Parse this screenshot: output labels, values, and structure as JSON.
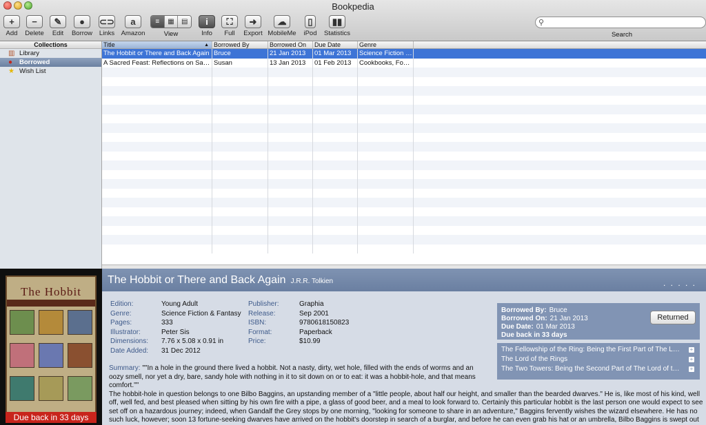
{
  "window": {
    "title": "Bookpedia"
  },
  "toolbar": {
    "add": "Add",
    "delete": "Delete",
    "edit": "Edit",
    "borrow": "Borrow",
    "links": "Links",
    "amazon": "Amazon",
    "view": "View",
    "info": "Info",
    "full": "Full",
    "export": "Export",
    "mobileme": "MobileMe",
    "ipod": "iPod",
    "statistics": "Statistics",
    "search_label": "Search"
  },
  "icons": {
    "add": "plus-icon",
    "delete": "minus-icon",
    "edit": "pencil-icon",
    "borrow": "person-icon",
    "links": "chain-icon",
    "amazon": "amazon-icon",
    "info": "info-icon",
    "full": "fullscreen-icon",
    "export": "arrow-right-icon",
    "mobileme": "cloud-icon",
    "ipod": "ipod-icon",
    "statistics": "bar-chart-icon"
  },
  "sidebar": {
    "header": "Collections",
    "items": [
      {
        "label": "Library",
        "icon": "books-icon"
      },
      {
        "label": "Borrowed",
        "icon": "person-icon",
        "selected": true
      },
      {
        "label": "Wish List",
        "icon": "star-icon"
      }
    ]
  },
  "table": {
    "columns": [
      "Title",
      "Borrowed By",
      "Borrowed On",
      "Due Date",
      "Genre"
    ],
    "rows": [
      [
        "The Hobbit or There and Back Again",
        "Bruce",
        "21 Jan 2013",
        "01 Mar 2013",
        "Science Fiction & Fantasy"
      ],
      [
        "A Sacred Feast: Reflections on Sacred Jewish Food",
        "Susan",
        "13 Jan 2013",
        "01 Feb 2013",
        "Cookbooks, Food & Wine"
      ]
    ]
  },
  "detail": {
    "title": "The Hobbit or There and Back Again",
    "author": "J.R.R. Tolkien",
    "dots": ". . . . .",
    "cover_title": "The Hobbit",
    "due_banner": "Due back in 33 days",
    "left_fields": [
      {
        "k": "Edition:",
        "v": "Young Adult"
      },
      {
        "k": "Genre:",
        "v": "Science Fiction & Fantasy"
      },
      {
        "k": "Pages:",
        "v": "333"
      },
      {
        "k": "Illustrator:",
        "v": "Peter Sis"
      },
      {
        "k": "Dimensions:",
        "v": "7.76 x 5.08 x 0.91 in"
      },
      {
        "k": "Date Added:",
        "v": "31 Dec 2012"
      }
    ],
    "right_fields": [
      {
        "k": "Publisher:",
        "v": "Graphia"
      },
      {
        "k": "Release:",
        "v": "Sep 2001"
      },
      {
        "k": "ISBN:",
        "v": "9780618150823"
      },
      {
        "k": "Format:",
        "v": "Paperback"
      },
      {
        "k": "Price:",
        "v": "$10.99"
      }
    ],
    "summary_label": "Summary:",
    "summary_quote": "\"\"In a hole in the ground there lived a hobbit. Not a nasty, dirty, wet hole, filled with the ends of worms and an oozy smell, nor yet a dry, bare, sandy hole with nothing in it to sit down on or to eat: it was a hobbit-hole, and that means comfort.\"\"",
    "summary_body": "The hobbit-hole in question belongs to one Bilbo Baggins, an upstanding member of a \"little people, about half our height, and smaller than the bearded dwarves.\" He is, like most of his kind, well off, well fed, and best pleased when sitting by his own fire with a pipe, a glass of good beer, and a meal to look forward to. Certainly this particular hobbit is the last person one would expect to see set off on a hazardous journey; indeed, when Gandalf the Grey stops by one morning, \"looking for someone to share in an adventure,\" Baggins fervently wishes the wizard elsewhere. He has no such luck, however; soon 13 fortune-seeking dwarves have arrived on the hobbit's doorstep in search of a burglar, and before he can even grab his hat or an umbrella, Bilbo Baggins is swept out his door and into a dangerous adventure.",
    "loan": {
      "borrowed_by_label": "Borrowed By:",
      "borrowed_by": "Bruce",
      "borrowed_on_label": "Borrowed On:",
      "borrowed_on": "21 Jan 2013",
      "due_date_label": "Due Date:",
      "due_date": "01 Mar 2013",
      "due_back": "Due back in 33 days",
      "returned_button": "Returned"
    },
    "series": [
      "The Fellowship of the Ring: Being the First Part of The Lord of the Rings",
      "The Lord of the Rings",
      "The Two Towers: Being the Second Part of The Lord of the Rings"
    ]
  },
  "colors": {
    "selection": "#3d74d6",
    "detail_header": "#7388a8",
    "due_banner": "#c8241c"
  }
}
